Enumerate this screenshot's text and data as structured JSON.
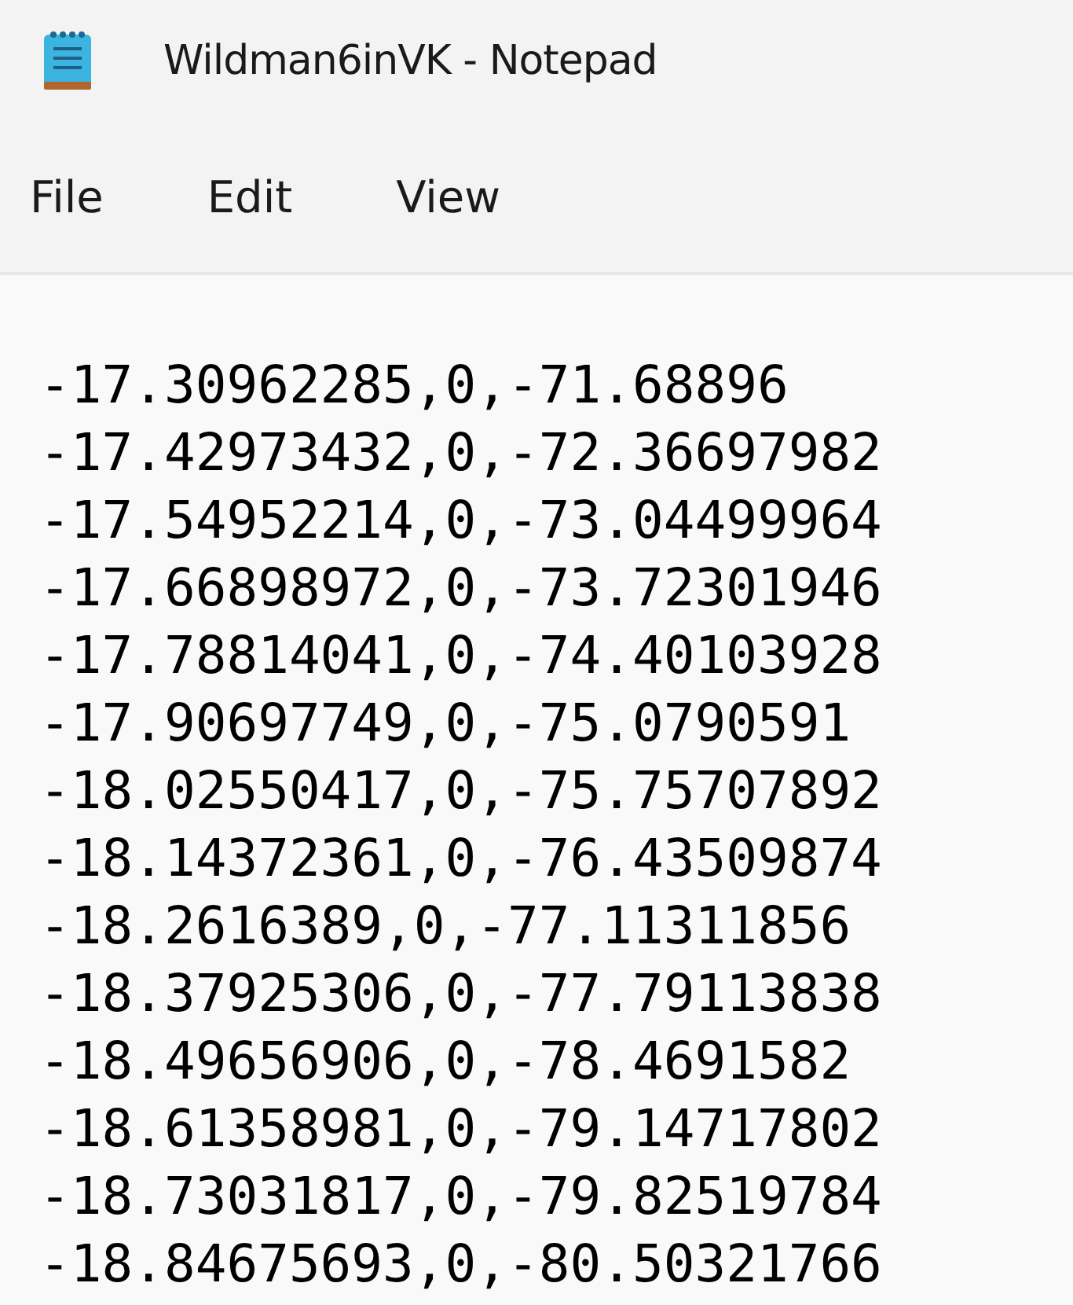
{
  "window": {
    "title": "Wildman6inVK - Notepad"
  },
  "menu": [
    "File",
    "Edit",
    "View"
  ],
  "lines": [
    "-17.30962285,0,-71.68896",
    "-17.42973432,0,-72.36697982",
    "-17.54952214,0,-73.04499964",
    "-17.66898972,0,-73.72301946",
    "-17.78814041,0,-74.40103928",
    "-17.90697749,0,-75.0790591",
    "-18.02550417,0,-75.75707892",
    "-18.14372361,0,-76.43509874",
    "-18.2616389,0,-77.11311856",
    "-18.37925306,0,-77.79113838",
    "-18.49656906,0,-78.4691582",
    "-18.61358981,0,-79.14717802",
    "-18.73031817,0,-79.82519784",
    "-18.84675693,0,-80.50321766"
  ]
}
